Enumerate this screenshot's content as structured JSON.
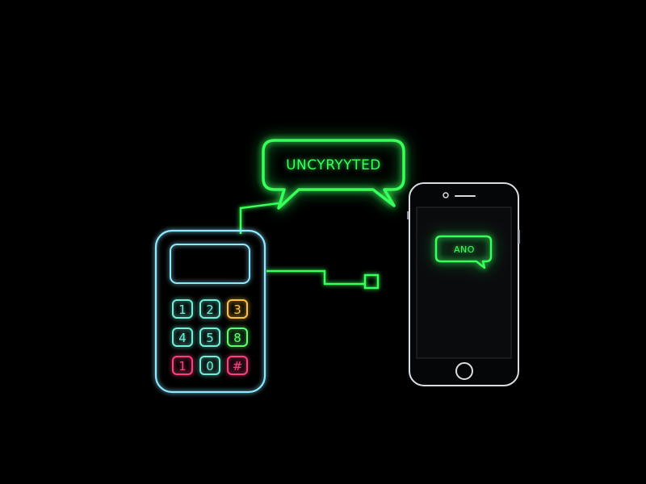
{
  "scene": {
    "background_color": "#000000",
    "accent_green": "#39ff5a",
    "accent_cyan": "#8fe8ff"
  },
  "speech_bubble": {
    "text": "UNCYRYYTED",
    "color": "#39ff5a"
  },
  "keypad_device": {
    "outline_color": "#8fe8ff",
    "keys": [
      {
        "label": "1",
        "color": "#6ff0d8"
      },
      {
        "label": "2",
        "color": "#6ff0d8"
      },
      {
        "label": "3",
        "color": "#ffc23d"
      },
      {
        "label": "4",
        "color": "#6ff0d8"
      },
      {
        "label": "5",
        "color": "#6ff0d8"
      },
      {
        "label": "8",
        "color": "#5dff6a"
      },
      {
        "label": "1",
        "color": "#ff3d7f"
      },
      {
        "label": "0",
        "color": "#6ff0d8"
      },
      {
        "label": "#",
        "color": "#ff3d7f"
      }
    ]
  },
  "phone": {
    "outline_color": "#d8dde3",
    "message_text": "ANO",
    "message_color": "#39ff5a"
  }
}
